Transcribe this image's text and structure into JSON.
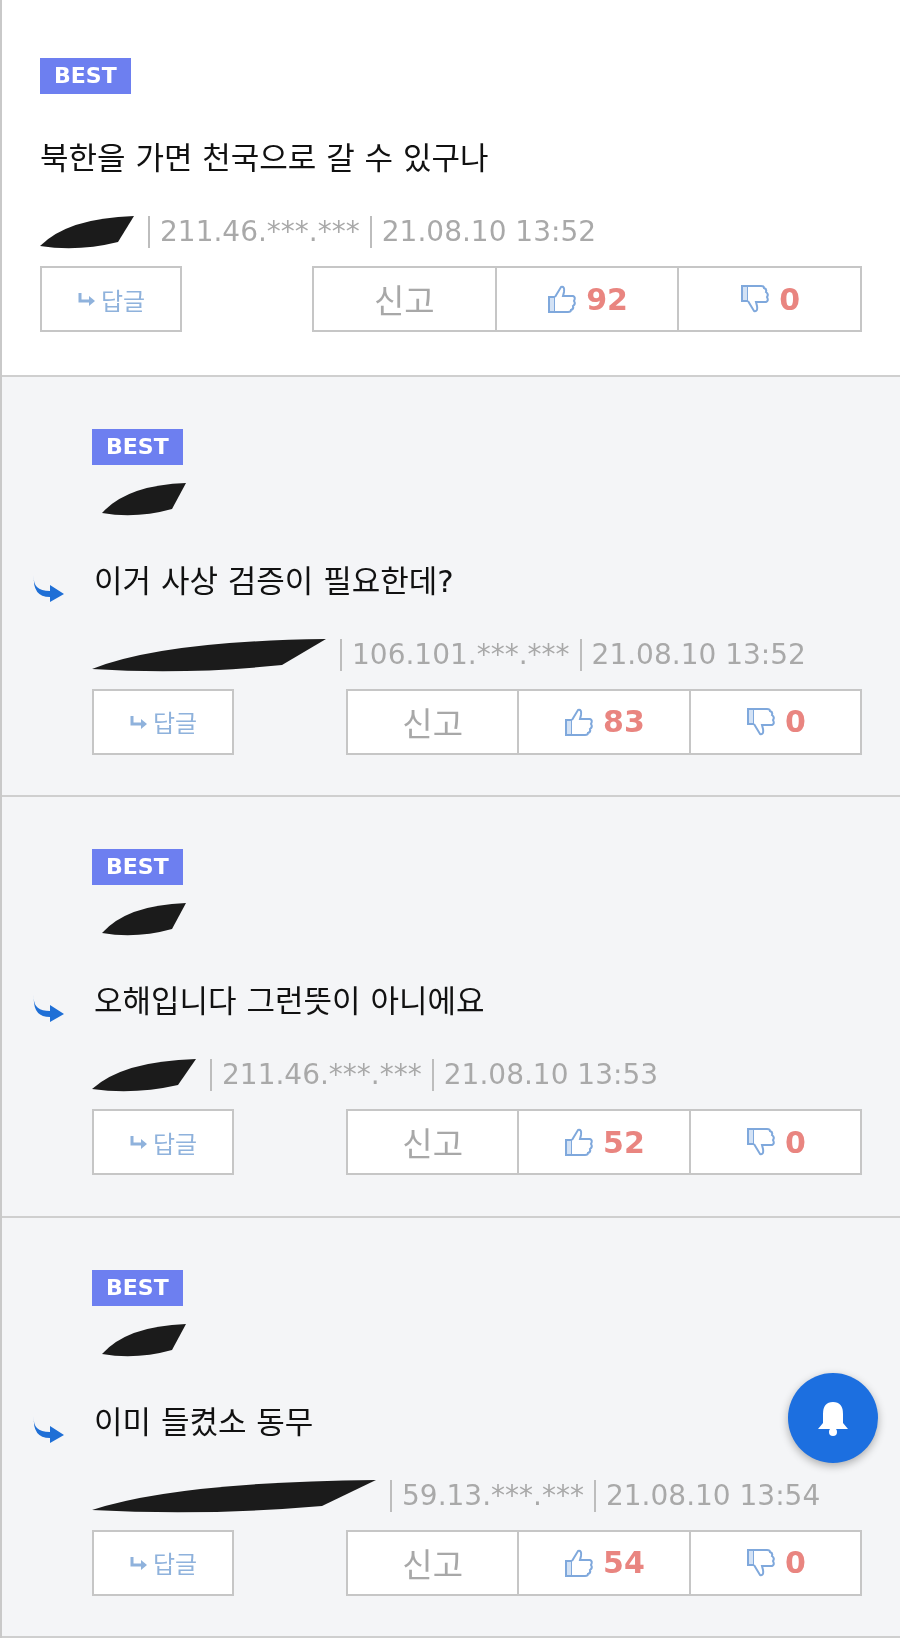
{
  "comments": [
    {
      "kind": "comment",
      "badge": "BEST",
      "author_redacted": true,
      "text": "북한을 가면 천국으로 갈 수 있구나",
      "ip": "211.46.***.***",
      "date": "21.08.10 13:52",
      "reply_label": "답글",
      "report_label": "신고",
      "likes": "92",
      "dislikes": "0"
    },
    {
      "kind": "reply",
      "badge": "BEST",
      "author_redacted": true,
      "text": "이거 사상 검증이 필요한데?",
      "ip": "106.101.***.***",
      "date": "21.08.10 13:52",
      "reply_label": "답글",
      "report_label": "신고",
      "likes": "83",
      "dislikes": "0"
    },
    {
      "kind": "reply",
      "badge": "BEST",
      "author_redacted": true,
      "text": "오해입니다 그런뜻이 아니에요",
      "ip": "211.46.***.***",
      "date": "21.08.10 13:53",
      "reply_label": "답글",
      "report_label": "신고",
      "likes": "52",
      "dislikes": "0"
    },
    {
      "kind": "reply",
      "badge": "BEST",
      "author_redacted": true,
      "text": "이미 들켰소 동무",
      "ip": "59.13.***.***",
      "date": "21.08.10 13:54",
      "reply_label": "답글",
      "report_label": "신고",
      "likes": "54",
      "dislikes": "0"
    }
  ]
}
